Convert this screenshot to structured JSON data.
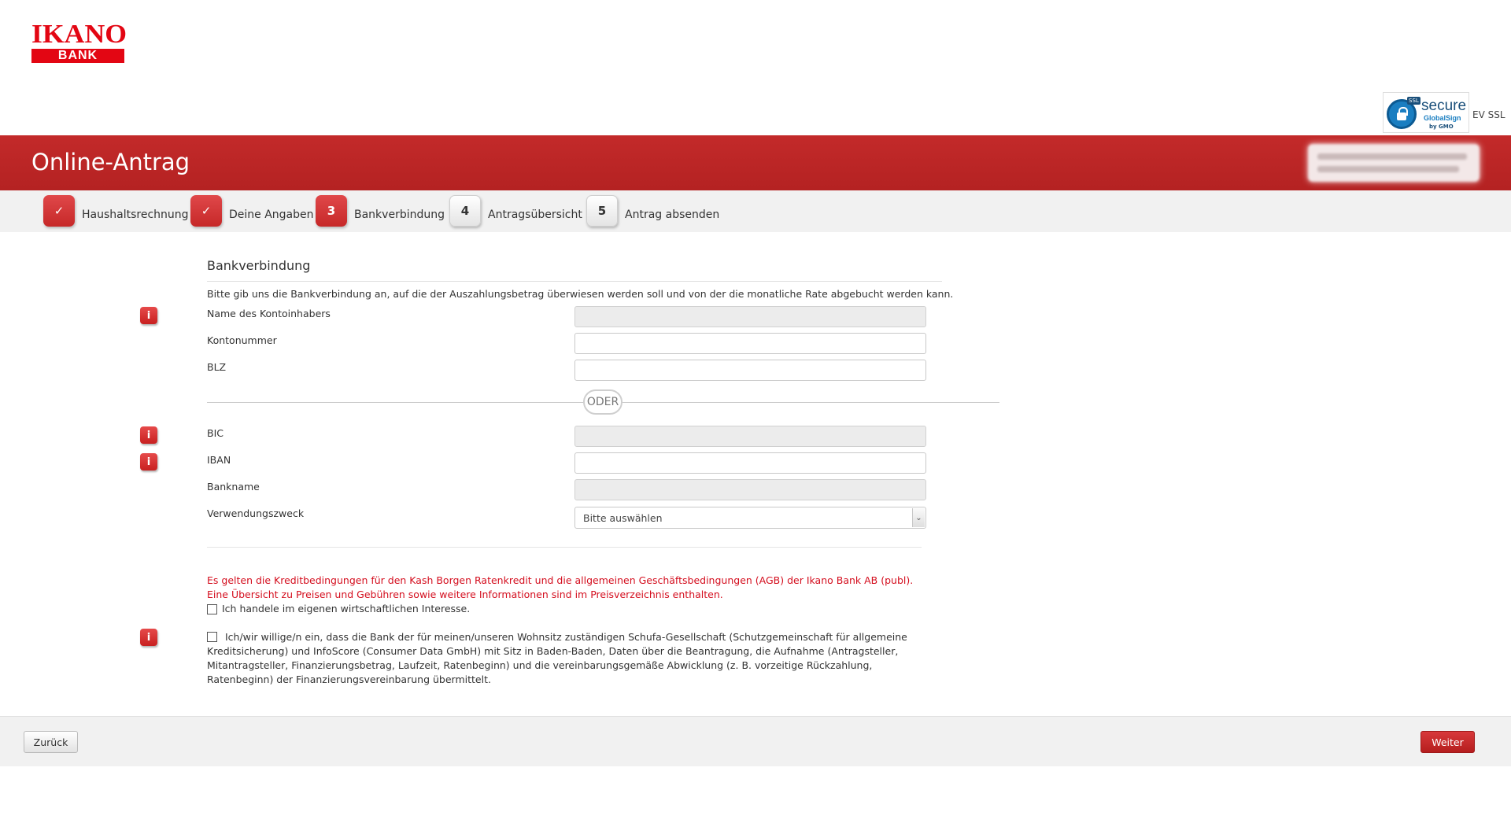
{
  "brand": {
    "logo_top": "IKANO",
    "logo_bottom": "BANK",
    "colors": {
      "primary": "#e30613",
      "banner": "#bf2727"
    }
  },
  "ssl_badge": {
    "tag": "SSL",
    "secure": "secure",
    "provider": "GlobalSign",
    "sub": "by GMO",
    "label": "EV SSL"
  },
  "banner": {
    "title": "Online-Antrag"
  },
  "steps": [
    {
      "num": "✓",
      "label": "Haushaltsrechnung",
      "state": "done"
    },
    {
      "num": "✓",
      "label": "Deine Angaben",
      "state": "done"
    },
    {
      "num": "3",
      "label": "Bankverbindung",
      "state": "active"
    },
    {
      "num": "4",
      "label": "Antragsübersicht",
      "state": "todo"
    },
    {
      "num": "5",
      "label": "Antrag absenden",
      "state": "todo"
    }
  ],
  "form": {
    "title": "Bankverbindung",
    "intro": "Bitte gib uns die Bankverbindung an, auf die der Auszahlungsbetrag überwiesen werden soll und von der die monatliche Rate abgebucht werden kann.",
    "info_icon": "i",
    "fields": {
      "kontoinhaber": {
        "label": "Name des Kontoinhabers",
        "value": ""
      },
      "kontonummer": {
        "label": "Kontonummer",
        "value": ""
      },
      "blz": {
        "label": "BLZ",
        "value": ""
      },
      "bic": {
        "label": "BIC",
        "value": ""
      },
      "iban": {
        "label": "IBAN",
        "value": ""
      },
      "bankname": {
        "label": "Bankname",
        "value": ""
      },
      "verwendungszweck": {
        "label": "Verwendungszweck",
        "selected": "Bitte auswählen"
      }
    },
    "oder": "ODER",
    "terms_line1": "Es gelten die Kreditbedingungen für den Kash Borgen Ratenkredit und die allgemeinen Geschäftsbedingungen (AGB) der Ikano Bank AB (publ).",
    "terms_line2": "Eine Übersicht zu Preisen und Gebühren sowie weitere Informationen sind im Preisverzeichnis enthalten.",
    "checkbox_interest": "Ich handele im eigenen wirtschaftlichen Interesse.",
    "checkbox_schufa": "Ich/wir willige/n ein, dass die Bank der für meinen/unseren Wohnsitz zuständigen Schufa-Gesellschaft (Schutzgemeinschaft für allgemeine Kreditsicherung) und InfoScore (Consumer Data GmbH) mit Sitz in Baden-Baden, Daten über die Beantragung, die Aufnahme (Antragsteller, Mitantragsteller, Finanzierungsbetrag, Laufzeit, Ratenbeginn) und die vereinbarungsgemäße Abwicklung (z. B. vorzeitige Rückzahlung, Ratenbeginn) der Finanzierungsvereinbarung übermittelt."
  },
  "footer": {
    "back_label": "Zurück",
    "next_label": "Weiter"
  }
}
